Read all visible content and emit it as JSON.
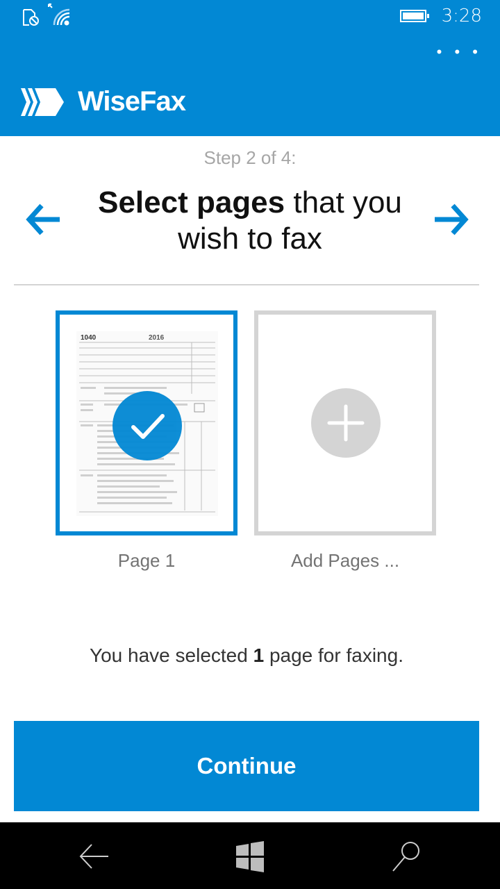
{
  "status_bar": {
    "time": "3:28",
    "icons": [
      "sim-blocked-icon",
      "wifi-icon",
      "battery-icon"
    ]
  },
  "app_bar": {
    "more_label": "• • •",
    "app_name": "WiseFax",
    "logo_icon": "wisefax-chevrons-logo"
  },
  "wizard": {
    "step_label": "Step 2 of 4:",
    "title_bold": "Select pages",
    "title_rest": " that you wish to fax",
    "back_icon": "arrow-left-icon",
    "next_icon": "arrow-right-icon"
  },
  "pages": [
    {
      "label": "Page 1",
      "selected": true,
      "thumbnail": "tax-form-1040-thumbnail"
    },
    {
      "label": "Add Pages ...",
      "type": "add"
    }
  ],
  "summary": {
    "prefix": "You have selected ",
    "count": "1",
    "suffix": " page for faxing."
  },
  "continue_label": "Continue",
  "colors": {
    "accent": "#0288d4",
    "placeholder_gray": "#d4d4d4"
  },
  "nav_bar": {
    "items": [
      "back-icon",
      "windows-start-icon",
      "search-icon"
    ]
  }
}
